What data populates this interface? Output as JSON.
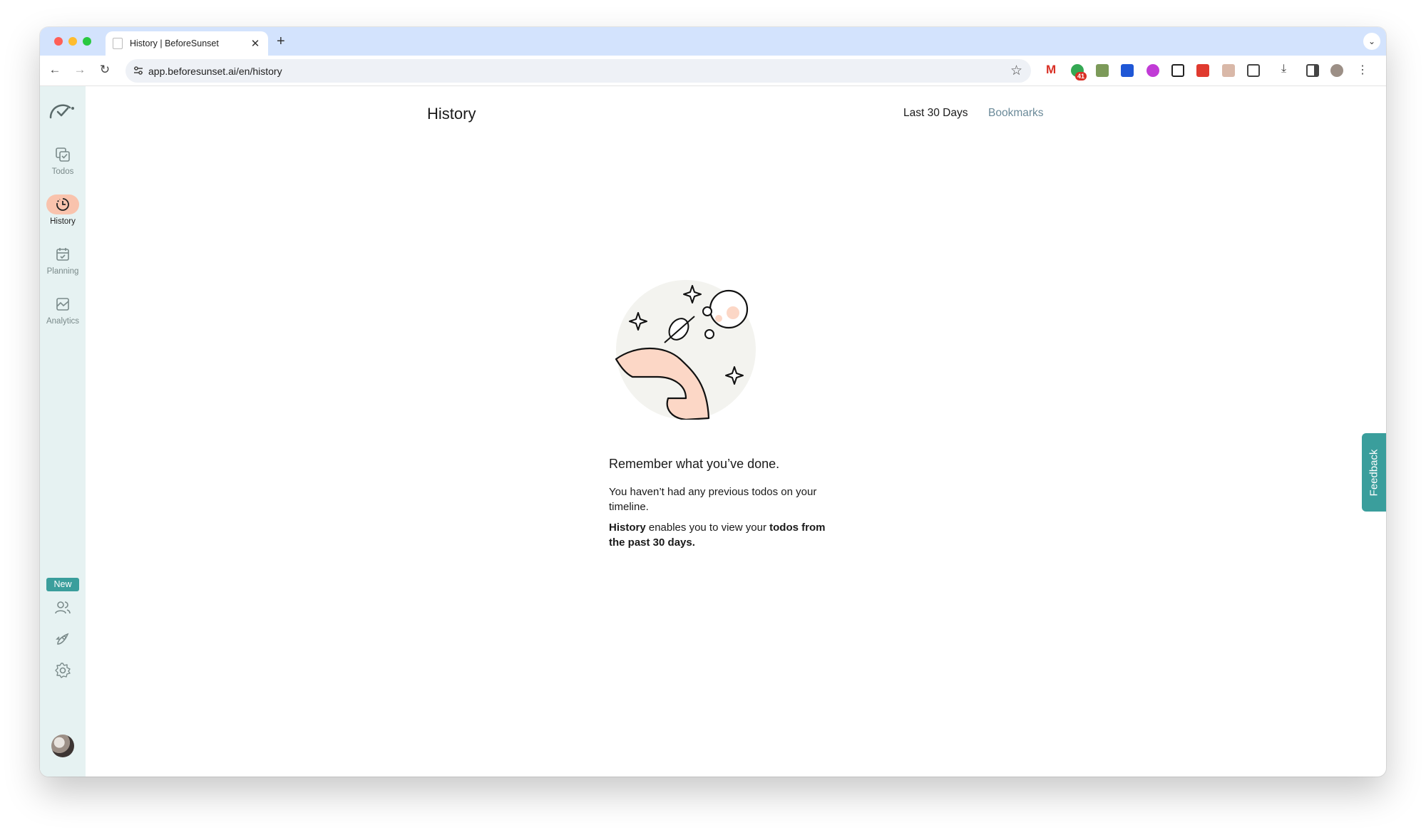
{
  "browser": {
    "tab_title": "History | BeforeSunset",
    "new_tab": "+",
    "close": "✕",
    "url": "app.beforesunset.ai/en/history",
    "extension_badge": "41"
  },
  "sidebar": {
    "items": [
      {
        "label": "Todos",
        "icon": "todos-icon"
      },
      {
        "label": "History",
        "icon": "history-icon",
        "active": true
      },
      {
        "label": "Planning",
        "icon": "planning-icon"
      },
      {
        "label": "Analytics",
        "icon": "analytics-icon"
      }
    ],
    "new_badge": "New"
  },
  "main": {
    "title": "History",
    "tabs": [
      {
        "label": "Last 30 Days",
        "active": true
      },
      {
        "label": "Bookmarks"
      }
    ],
    "empty": {
      "heading": "Remember what you’ve done.",
      "line1": "You haven’t had any previous todos on your timeline.",
      "line2_bold1": "History",
      "line2_mid": " enables you to view your ",
      "line2_bold2": "todos from the past 30 days."
    }
  },
  "feedback_label": "Feedback",
  "colors": {
    "accent": "#3a9e9c",
    "active_nav": "#f9c3ad",
    "sidebar_bg": "#e6f2f2"
  }
}
